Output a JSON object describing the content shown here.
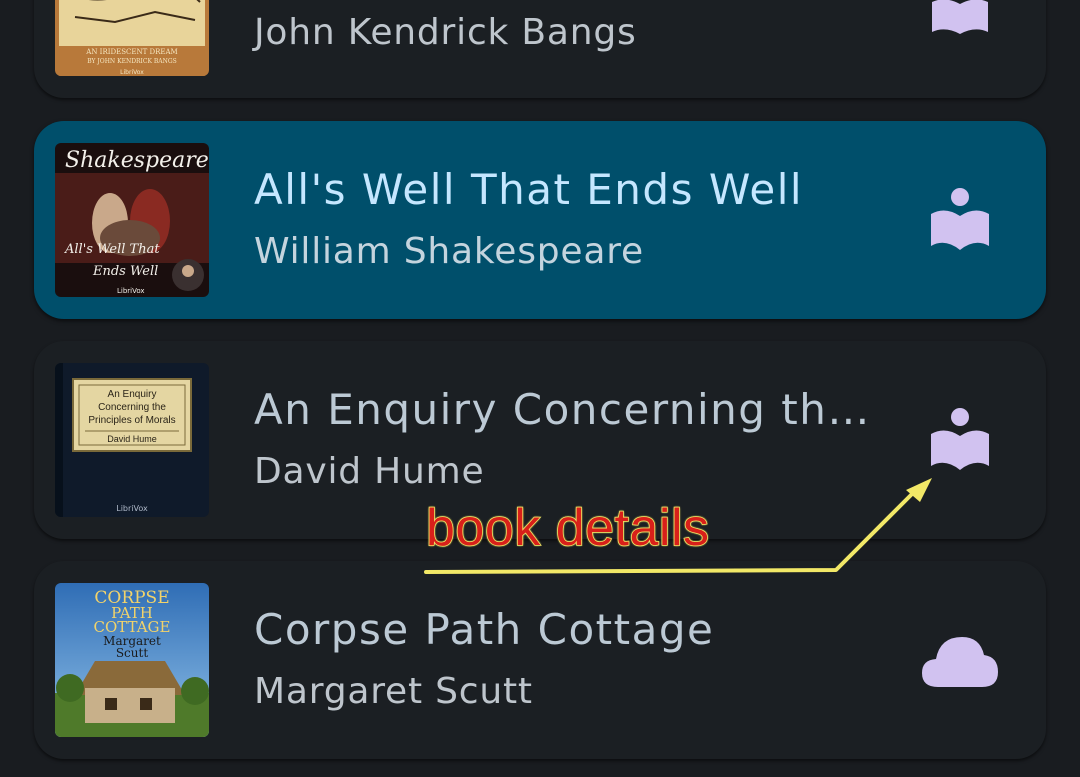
{
  "books": [
    {
      "title": "",
      "author": "John Kendrick Bangs",
      "cover_icon": "book-cover-bangs",
      "cover_texts": [
        "AN IRIDESCENT DREAM",
        "BY JOHN KENDRICK BANGS",
        "LibriVox"
      ],
      "action_icon": "book-details-icon",
      "selected": false
    },
    {
      "title": "All's Well That Ends Well",
      "author": "William Shakespeare",
      "cover_icon": "book-cover-shakespeare",
      "cover_texts": [
        "Shakespeare",
        "All's Well That",
        "Ends Well",
        "LibriVox"
      ],
      "action_icon": "book-details-icon",
      "selected": true
    },
    {
      "title": "An Enquiry Concerning the …",
      "author": "David Hume",
      "cover_icon": "book-cover-hume",
      "cover_texts": [
        "An Enquiry",
        "Concerning the",
        "Principles of Morals",
        "David Hume",
        "LibriVox"
      ],
      "action_icon": "book-details-icon",
      "selected": false
    },
    {
      "title": "Corpse Path Cottage",
      "author": "Margaret Scutt",
      "cover_icon": "book-cover-corpse-path",
      "cover_texts": [
        "CORPSE",
        "PATH",
        "COTTAGE",
        "Margaret",
        "Scutt"
      ],
      "action_icon": "cloud-download-icon",
      "selected": false
    }
  ],
  "annotation": {
    "label": "book details",
    "color": "#d8201a",
    "outline_color": "#f2e867"
  },
  "colors": {
    "background": "#191c20",
    "card": "#1b1f23",
    "card_selected": "#004f6b",
    "icon": "#d1c2f0"
  }
}
